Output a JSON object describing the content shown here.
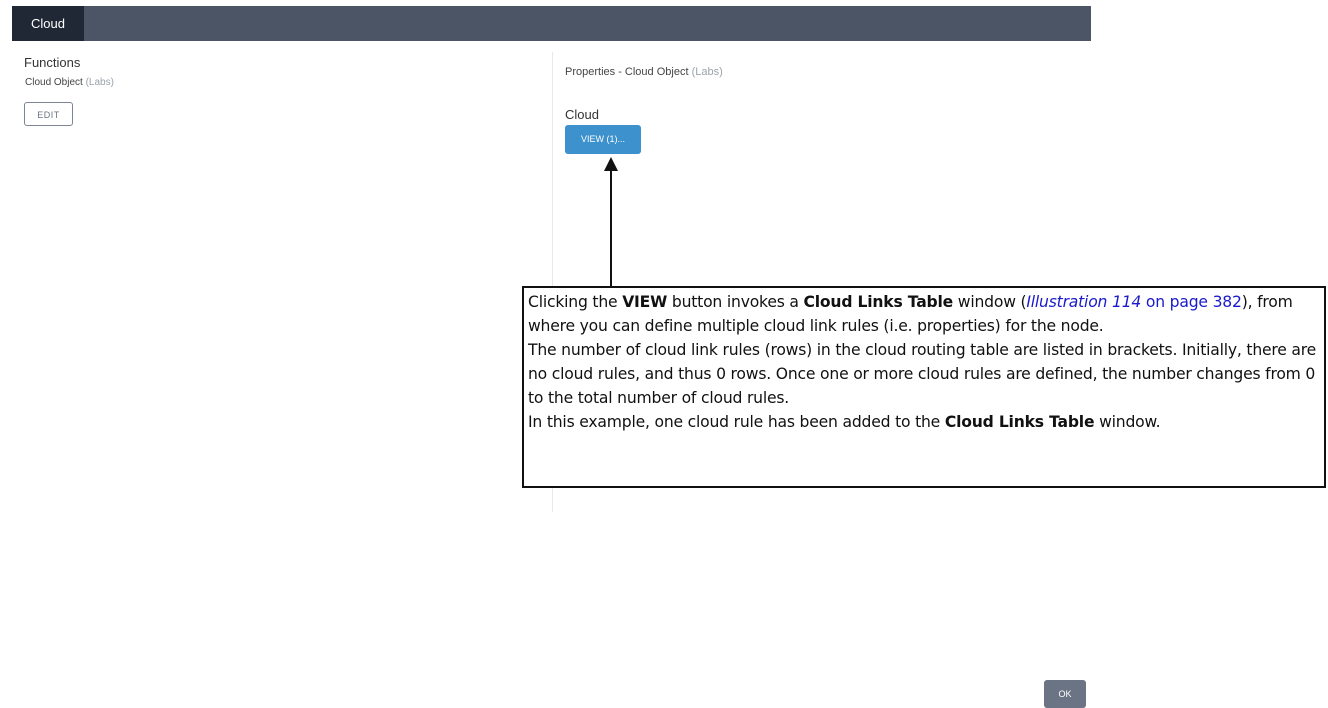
{
  "header": {
    "tab_label": "Cloud"
  },
  "left": {
    "title": "Functions",
    "item_name": "Cloud Object",
    "item_tag": "(Labs)",
    "edit_label": "EDIT"
  },
  "right": {
    "props_prefix": "Properties  - Cloud Object",
    "props_tag": "(Labs)",
    "cloud_label": "Cloud",
    "view_label": "VIEW (1)..."
  },
  "callout": {
    "p1_a": "Clicking the ",
    "p1_b": "VIEW",
    "p1_c": " button invokes a ",
    "p1_d": "Cloud Links Table",
    "p1_e": " window (",
    "p1_link_italic": "Illustration 114",
    "p1_link_rest": " on page 382",
    "p1_f": "), from where you can define multiple cloud link rules (i.e. properties) for the node.",
    "p2": "The number of cloud link rules (rows) in the cloud routing table are listed in brackets. Initially, there are no cloud rules, and thus 0 rows. Once one or more cloud rules are defined, the number changes from 0 to the total number of cloud rules.",
    "p3_a": "In this example, one cloud rule has been added to the ",
    "p3_b": "Cloud Links Table",
    "p3_c": " window."
  },
  "footer": {
    "ok_label": "OK"
  }
}
